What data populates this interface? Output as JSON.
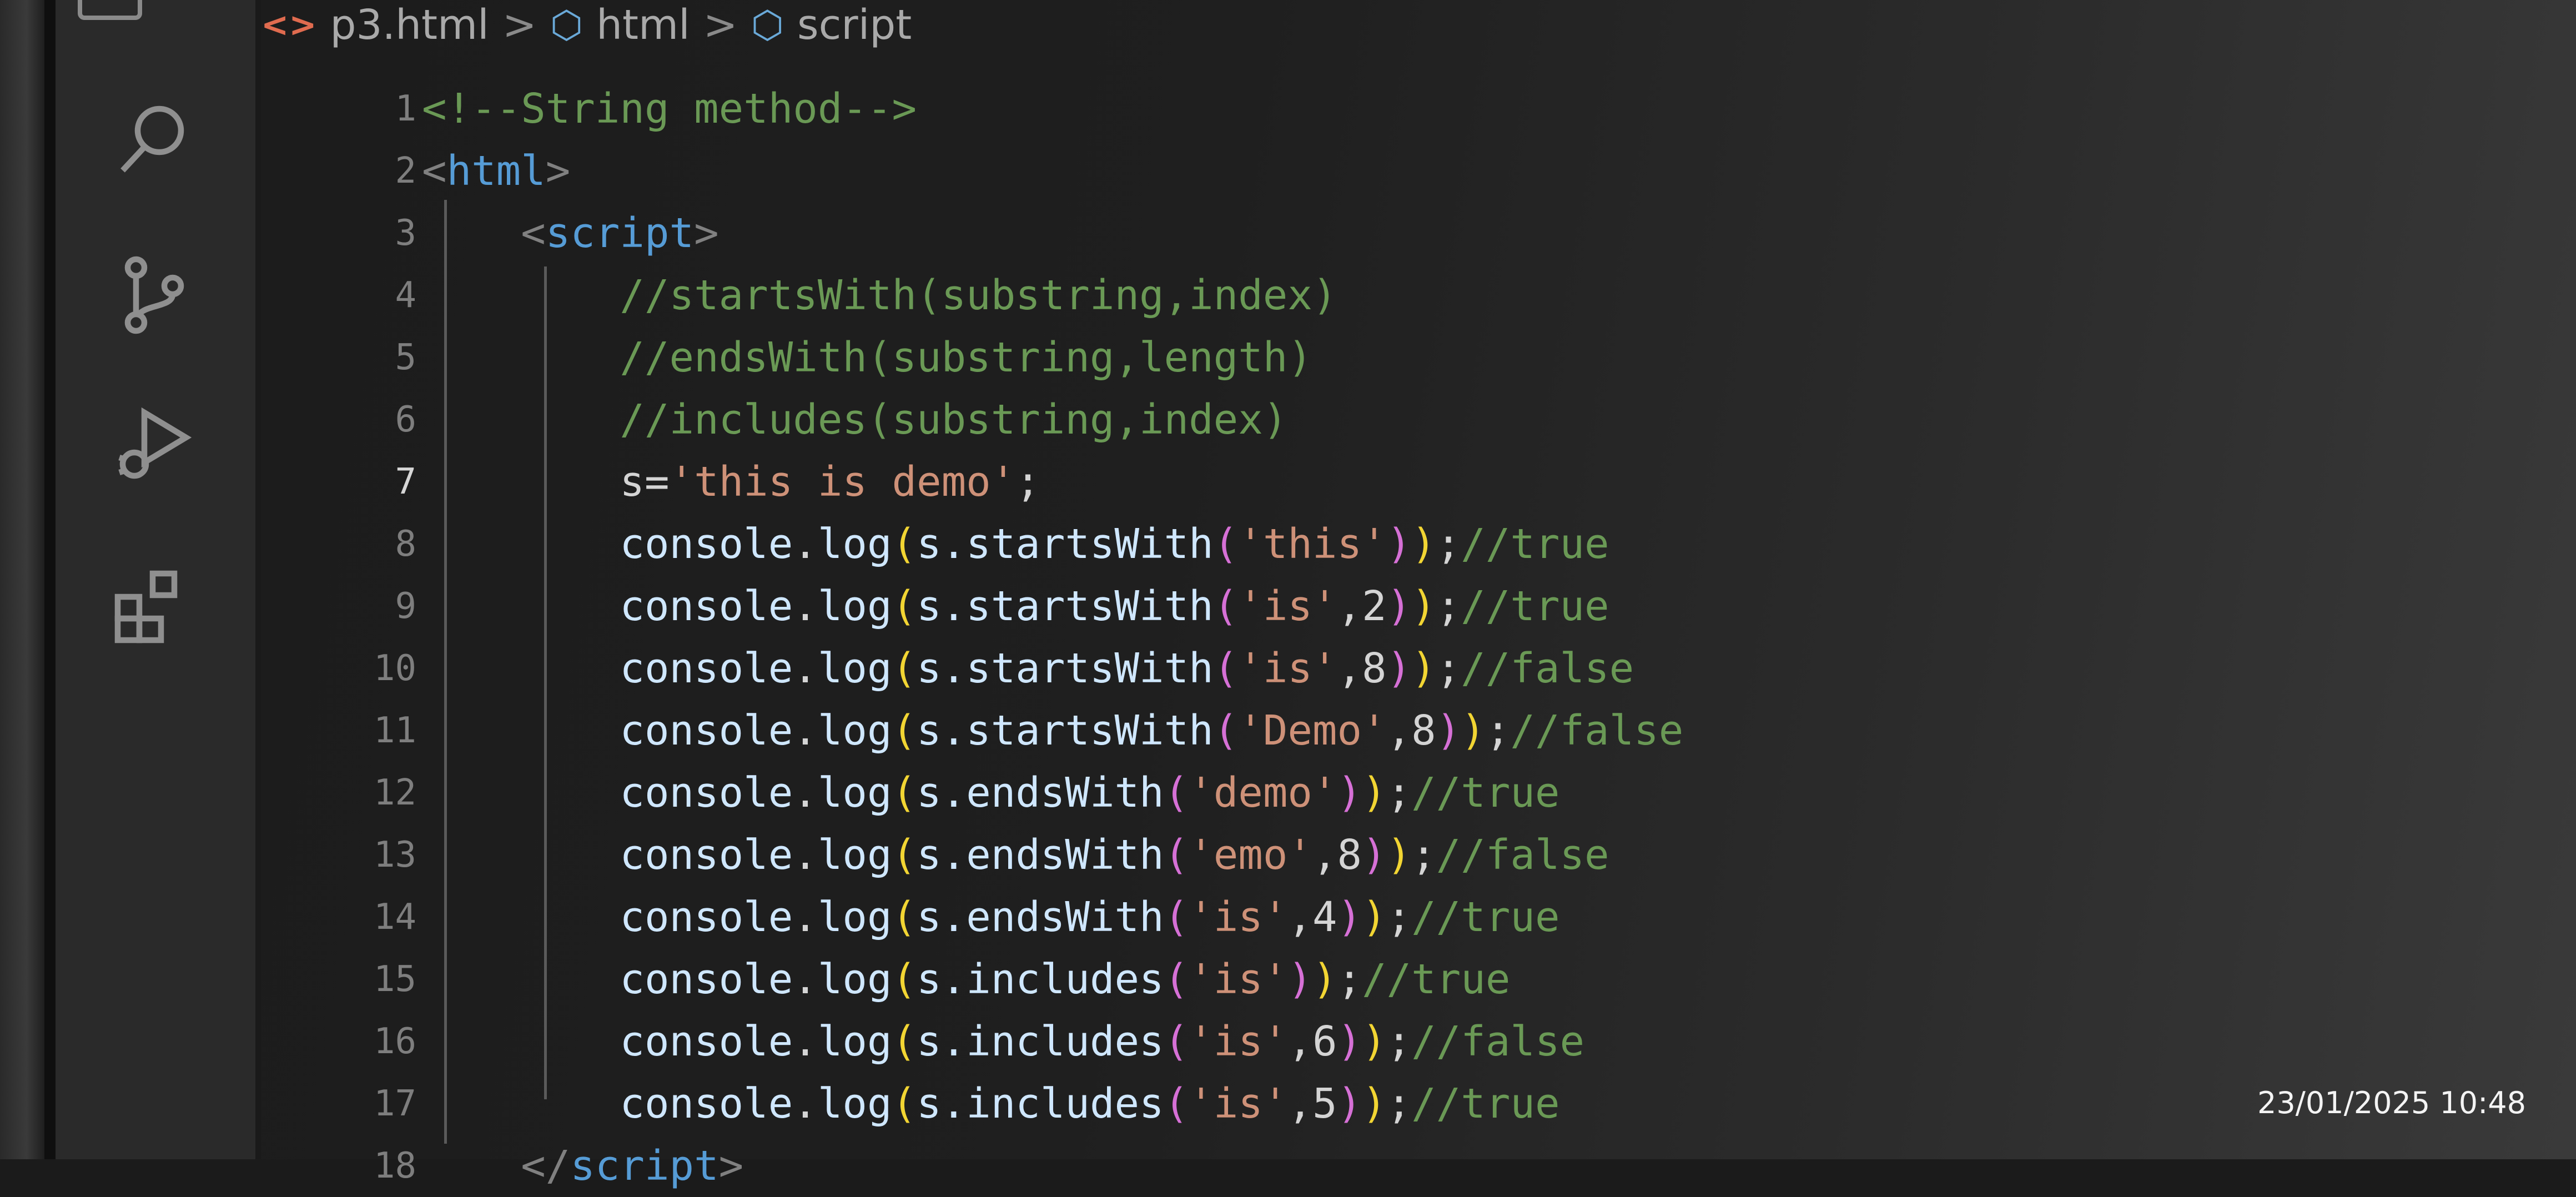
{
  "breadcrumb": {
    "file": "p3.html",
    "separator": ">",
    "items": [
      "html",
      "script"
    ]
  },
  "activity_icons": [
    "search-icon",
    "source-control-icon",
    "run-debug-icon",
    "extensions-icon"
  ],
  "line_numbers": [
    "1",
    "2",
    "3",
    "4",
    "5",
    "6",
    "7",
    "8",
    "9",
    "10",
    "11",
    "12",
    "13",
    "14",
    "15",
    "16",
    "17",
    "18"
  ],
  "current_line": "7",
  "code_lines": [
    [
      {
        "t": "<!--String method-->",
        "k": "comment"
      }
    ],
    [
      {
        "t": "<",
        "k": "bracket"
      },
      {
        "t": "html",
        "k": "tag"
      },
      {
        "t": ">",
        "k": "bracket"
      }
    ],
    [
      {
        "t": "    ",
        "k": "plain"
      },
      {
        "t": "<",
        "k": "bracket"
      },
      {
        "t": "script",
        "k": "tag"
      },
      {
        "t": ">",
        "k": "bracket"
      }
    ],
    [
      {
        "t": "        ",
        "k": "plain"
      },
      {
        "t": "//startsWith(substring,index)",
        "k": "comment"
      }
    ],
    [
      {
        "t": "        ",
        "k": "plain"
      },
      {
        "t": "//endsWith(substring,length)",
        "k": "comment"
      }
    ],
    [
      {
        "t": "        ",
        "k": "plain"
      },
      {
        "t": "//includes(substring,index)",
        "k": "comment"
      }
    ],
    [
      {
        "t": "        ",
        "k": "plain"
      },
      {
        "t": "s=",
        "k": "plain"
      },
      {
        "t": "'this is demo'",
        "k": "str"
      },
      {
        "t": ";",
        "k": "plain"
      }
    ],
    [
      {
        "t": "        ",
        "k": "plain"
      },
      {
        "t": "console",
        "k": "ws"
      },
      {
        "t": ".",
        "k": "plain"
      },
      {
        "t": "log",
        "k": "ws"
      },
      {
        "t": "(",
        "k": "paren1"
      },
      {
        "t": "s.",
        "k": "ws"
      },
      {
        "t": "startsWith",
        "k": "ws"
      },
      {
        "t": "(",
        "k": "paren2"
      },
      {
        "t": "'this'",
        "k": "str"
      },
      {
        "t": ")",
        "k": "paren2"
      },
      {
        "t": ")",
        "k": "paren1"
      },
      {
        "t": ";",
        "k": "plain"
      },
      {
        "t": "//true",
        "k": "comment"
      }
    ],
    [
      {
        "t": "        ",
        "k": "plain"
      },
      {
        "t": "console",
        "k": "ws"
      },
      {
        "t": ".",
        "k": "plain"
      },
      {
        "t": "log",
        "k": "ws"
      },
      {
        "t": "(",
        "k": "paren1"
      },
      {
        "t": "s.",
        "k": "ws"
      },
      {
        "t": "startsWith",
        "k": "ws"
      },
      {
        "t": "(",
        "k": "paren2"
      },
      {
        "t": "'is'",
        "k": "str"
      },
      {
        "t": ",2",
        "k": "plain"
      },
      {
        "t": ")",
        "k": "paren2"
      },
      {
        "t": ")",
        "k": "paren1"
      },
      {
        "t": ";",
        "k": "plain"
      },
      {
        "t": "//true",
        "k": "comment"
      }
    ],
    [
      {
        "t": "        ",
        "k": "plain"
      },
      {
        "t": "console",
        "k": "ws"
      },
      {
        "t": ".",
        "k": "plain"
      },
      {
        "t": "log",
        "k": "ws"
      },
      {
        "t": "(",
        "k": "paren1"
      },
      {
        "t": "s.",
        "k": "ws"
      },
      {
        "t": "startsWith",
        "k": "ws"
      },
      {
        "t": "(",
        "k": "paren2"
      },
      {
        "t": "'is'",
        "k": "str"
      },
      {
        "t": ",8",
        "k": "plain"
      },
      {
        "t": ")",
        "k": "paren2"
      },
      {
        "t": ")",
        "k": "paren1"
      },
      {
        "t": ";",
        "k": "plain"
      },
      {
        "t": "//false",
        "k": "comment"
      }
    ],
    [
      {
        "t": "        ",
        "k": "plain"
      },
      {
        "t": "console",
        "k": "ws"
      },
      {
        "t": ".",
        "k": "plain"
      },
      {
        "t": "log",
        "k": "ws"
      },
      {
        "t": "(",
        "k": "paren1"
      },
      {
        "t": "s.",
        "k": "ws"
      },
      {
        "t": "startsWith",
        "k": "ws"
      },
      {
        "t": "(",
        "k": "paren2"
      },
      {
        "t": "'Demo'",
        "k": "str"
      },
      {
        "t": ",8",
        "k": "plain"
      },
      {
        "t": ")",
        "k": "paren2"
      },
      {
        "t": ")",
        "k": "paren1"
      },
      {
        "t": ";",
        "k": "plain"
      },
      {
        "t": "//false",
        "k": "comment"
      }
    ],
    [
      {
        "t": "        ",
        "k": "plain"
      },
      {
        "t": "console",
        "k": "ws"
      },
      {
        "t": ".",
        "k": "plain"
      },
      {
        "t": "log",
        "k": "ws"
      },
      {
        "t": "(",
        "k": "paren1"
      },
      {
        "t": "s.",
        "k": "ws"
      },
      {
        "t": "endsWith",
        "k": "ws"
      },
      {
        "t": "(",
        "k": "paren2"
      },
      {
        "t": "'demo'",
        "k": "str"
      },
      {
        "t": ")",
        "k": "paren2"
      },
      {
        "t": ")",
        "k": "paren1"
      },
      {
        "t": ";",
        "k": "plain"
      },
      {
        "t": "//true",
        "k": "comment"
      }
    ],
    [
      {
        "t": "        ",
        "k": "plain"
      },
      {
        "t": "console",
        "k": "ws"
      },
      {
        "t": ".",
        "k": "plain"
      },
      {
        "t": "log",
        "k": "ws"
      },
      {
        "t": "(",
        "k": "paren1"
      },
      {
        "t": "s.",
        "k": "ws"
      },
      {
        "t": "endsWith",
        "k": "ws"
      },
      {
        "t": "(",
        "k": "paren2"
      },
      {
        "t": "'emo'",
        "k": "str"
      },
      {
        "t": ",8",
        "k": "plain"
      },
      {
        "t": ")",
        "k": "paren2"
      },
      {
        "t": ")",
        "k": "paren1"
      },
      {
        "t": ";",
        "k": "plain"
      },
      {
        "t": "//false",
        "k": "comment"
      }
    ],
    [
      {
        "t": "        ",
        "k": "plain"
      },
      {
        "t": "console",
        "k": "ws"
      },
      {
        "t": ".",
        "k": "plain"
      },
      {
        "t": "log",
        "k": "ws"
      },
      {
        "t": "(",
        "k": "paren1"
      },
      {
        "t": "s.",
        "k": "ws"
      },
      {
        "t": "endsWith",
        "k": "ws"
      },
      {
        "t": "(",
        "k": "paren2"
      },
      {
        "t": "'is'",
        "k": "str"
      },
      {
        "t": ",4",
        "k": "plain"
      },
      {
        "t": ")",
        "k": "paren2"
      },
      {
        "t": ")",
        "k": "paren1"
      },
      {
        "t": ";",
        "k": "plain"
      },
      {
        "t": "//true",
        "k": "comment"
      }
    ],
    [
      {
        "t": "        ",
        "k": "plain"
      },
      {
        "t": "console",
        "k": "ws"
      },
      {
        "t": ".",
        "k": "plain"
      },
      {
        "t": "log",
        "k": "ws"
      },
      {
        "t": "(",
        "k": "paren1"
      },
      {
        "t": "s.",
        "k": "ws"
      },
      {
        "t": "includes",
        "k": "ws"
      },
      {
        "t": "(",
        "k": "paren2"
      },
      {
        "t": "'is'",
        "k": "str"
      },
      {
        "t": ")",
        "k": "paren2"
      },
      {
        "t": ")",
        "k": "paren1"
      },
      {
        "t": ";",
        "k": "plain"
      },
      {
        "t": "//true",
        "k": "comment"
      }
    ],
    [
      {
        "t": "        ",
        "k": "plain"
      },
      {
        "t": "console",
        "k": "ws"
      },
      {
        "t": ".",
        "k": "plain"
      },
      {
        "t": "log",
        "k": "ws"
      },
      {
        "t": "(",
        "k": "paren1"
      },
      {
        "t": "s.",
        "k": "ws"
      },
      {
        "t": "includes",
        "k": "ws"
      },
      {
        "t": "(",
        "k": "paren2"
      },
      {
        "t": "'is'",
        "k": "str"
      },
      {
        "t": ",6",
        "k": "plain"
      },
      {
        "t": ")",
        "k": "paren2"
      },
      {
        "t": ")",
        "k": "paren1"
      },
      {
        "t": ";",
        "k": "plain"
      },
      {
        "t": "//false",
        "k": "comment"
      }
    ],
    [
      {
        "t": "        ",
        "k": "plain"
      },
      {
        "t": "console",
        "k": "ws"
      },
      {
        "t": ".",
        "k": "plain"
      },
      {
        "t": "log",
        "k": "ws"
      },
      {
        "t": "(",
        "k": "paren1"
      },
      {
        "t": "s.",
        "k": "ws"
      },
      {
        "t": "includes",
        "k": "ws"
      },
      {
        "t": "(",
        "k": "paren2"
      },
      {
        "t": "'is'",
        "k": "str"
      },
      {
        "t": ",5",
        "k": "plain"
      },
      {
        "t": ")",
        "k": "paren2"
      },
      {
        "t": ")",
        "k": "paren1"
      },
      {
        "t": ";",
        "k": "plain"
      },
      {
        "t": "//true",
        "k": "comment"
      }
    ],
    [
      {
        "t": "    ",
        "k": "plain"
      },
      {
        "t": "</",
        "k": "bracket"
      },
      {
        "t": "script",
        "k": "tag"
      },
      {
        "t": ">",
        "k": "bracket"
      }
    ]
  ],
  "timestamp": "23/01/2025  10:48"
}
